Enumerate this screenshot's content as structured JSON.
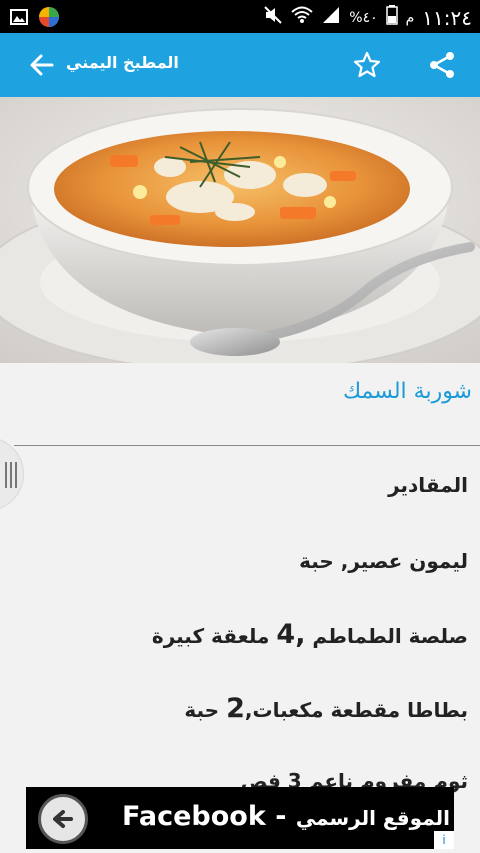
{
  "status_bar": {
    "time": "١١:٢٤",
    "period": "م",
    "battery_percent": "%٤٠",
    "icons": [
      "gallery-icon",
      "app-icon",
      "mute-icon",
      "wifi-icon",
      "signal-icon",
      "battery-icon"
    ]
  },
  "app_bar": {
    "title": "المطبخ اليمني",
    "back_icon": "arrow-back-icon",
    "favorite_icon": "star-outline-icon",
    "share_icon": "share-icon",
    "color": "#1ea2e0"
  },
  "recipe": {
    "title": "شوربة السمك",
    "lines": [
      "المقادير",
      "ليمون عصير, حبة",
      "صلصة الطماطم",
      "4",
      "ملعقة كبيرة",
      "بطاطا مقطعة مكعبات,",
      "2",
      "حبة",
      "ثوم مفروم ناعم 3 فص"
    ]
  },
  "ad": {
    "text": "Facebook - الموقع الرسمي",
    "brand": "Facebook",
    "separator": "-",
    "arabic": "الموقع الرسمي",
    "info": "i"
  },
  "colors": {
    "accent": "#1ea2e0",
    "title_text": "#1a9bd7"
  }
}
